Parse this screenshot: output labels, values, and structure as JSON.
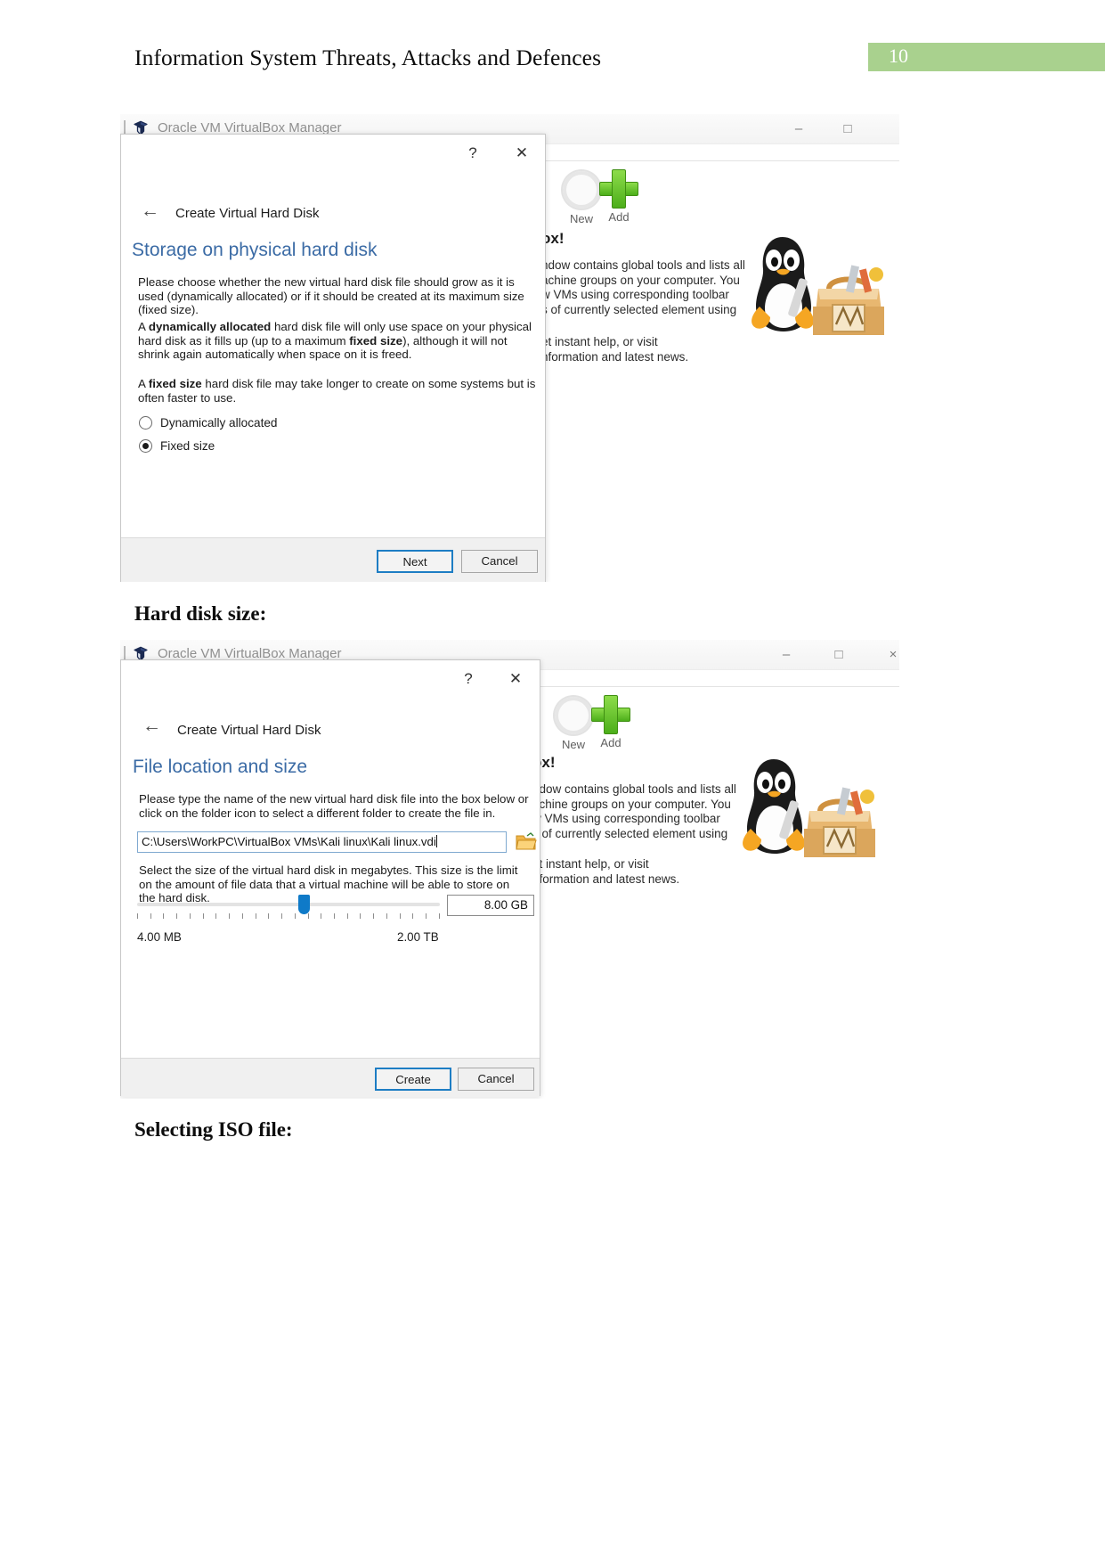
{
  "document": {
    "header_title": "Information System Threats, Attacks and Defences",
    "page_number": "10",
    "page_badge_color": "#a9d18e",
    "captions": {
      "hard_disk_size": "Hard disk size:",
      "selecting_iso": "Selecting ISO file:"
    }
  },
  "vbox_window": {
    "title": "Oracle VM VirtualBox Manager",
    "icon": "virtualbox-logo-icon",
    "controls": {
      "minimize": "–",
      "maximize": "□",
      "close": "×"
    },
    "toolbar": [
      {
        "label": "New",
        "icon": "gear-new-icon"
      },
      {
        "label": "Add",
        "icon": "green-plus-icon"
      }
    ],
    "welcome": {
      "heading_fragment": "ox!",
      "lines": [
        "ndow contains global tools and lists all",
        "achine groups on your computer. You",
        "w VMs using corresponding toolbar",
        "s of currently selected element using",
        "."
      ],
      "lines2": [
        "et instant help, or visit",
        "nformation and latest news."
      ]
    },
    "illustration": "tux-with-toolbox-image"
  },
  "wizard1": {
    "help_label": "?",
    "close_label": "✕",
    "back_icon": "back-arrow-icon",
    "breadcrumb": "Create Virtual Hard Disk",
    "heading": "Storage on physical hard disk",
    "paragraphs": [
      {
        "runs": [
          {
            "text": "Please choose whether the new virtual hard disk file should grow as it is used (dynamically allocated) or if it should be created at its maximum size (fixed size).",
            "bold": false
          }
        ]
      },
      {
        "runs": [
          {
            "text": "A ",
            "bold": false
          },
          {
            "text": "dynamically allocated",
            "bold": true
          },
          {
            "text": " hard disk file will only use space on your physical hard disk as it fills up (up to a maximum ",
            "bold": false
          },
          {
            "text": "fixed size",
            "bold": true
          },
          {
            "text": "), although it will not shrink again automatically when space on it is freed.",
            "bold": false
          }
        ]
      },
      {
        "runs": [
          {
            "text": "A ",
            "bold": false
          },
          {
            "text": "fixed size",
            "bold": true
          },
          {
            "text": " hard disk file may take longer to create on some systems but is often faster to use.",
            "bold": false
          }
        ]
      }
    ],
    "options": [
      {
        "label": "Dynamically allocated",
        "selected": false
      },
      {
        "label": "Fixed size",
        "selected": true
      }
    ],
    "buttons": {
      "next": "Next",
      "cancel": "Cancel",
      "primary": "next",
      "primary_border_color": "#1d7dc4"
    }
  },
  "wizard2": {
    "help_label": "?",
    "close_label": "✕",
    "back_icon": "back-arrow-icon",
    "breadcrumb": "Create Virtual Hard Disk",
    "heading": "File location and size",
    "paragraph_location": "Please type the name of the new virtual hard disk file into the box below or click on the folder icon to select a different folder to create the file in.",
    "path_value": "C:\\Users\\WorkPC\\VirtualBox VMs\\Kali linux\\Kali linux.vdi",
    "folder_icon": "open-folder-icon",
    "paragraph_size": "Select the size of the virtual hard disk in megabytes. This size is the limit on the amount of file data that a virtual machine will be able to store on the hard disk.",
    "size_value": "8.00 GB",
    "slider": {
      "min_label": "4.00 MB",
      "max_label": "2.00 TB",
      "thumb_percent": 45,
      "tick_count": 24,
      "thumb_color": "#0f7ac8"
    },
    "buttons": {
      "create": "Create",
      "cancel": "Cancel",
      "primary": "create",
      "primary_border_color": "#1d7dc4"
    }
  }
}
